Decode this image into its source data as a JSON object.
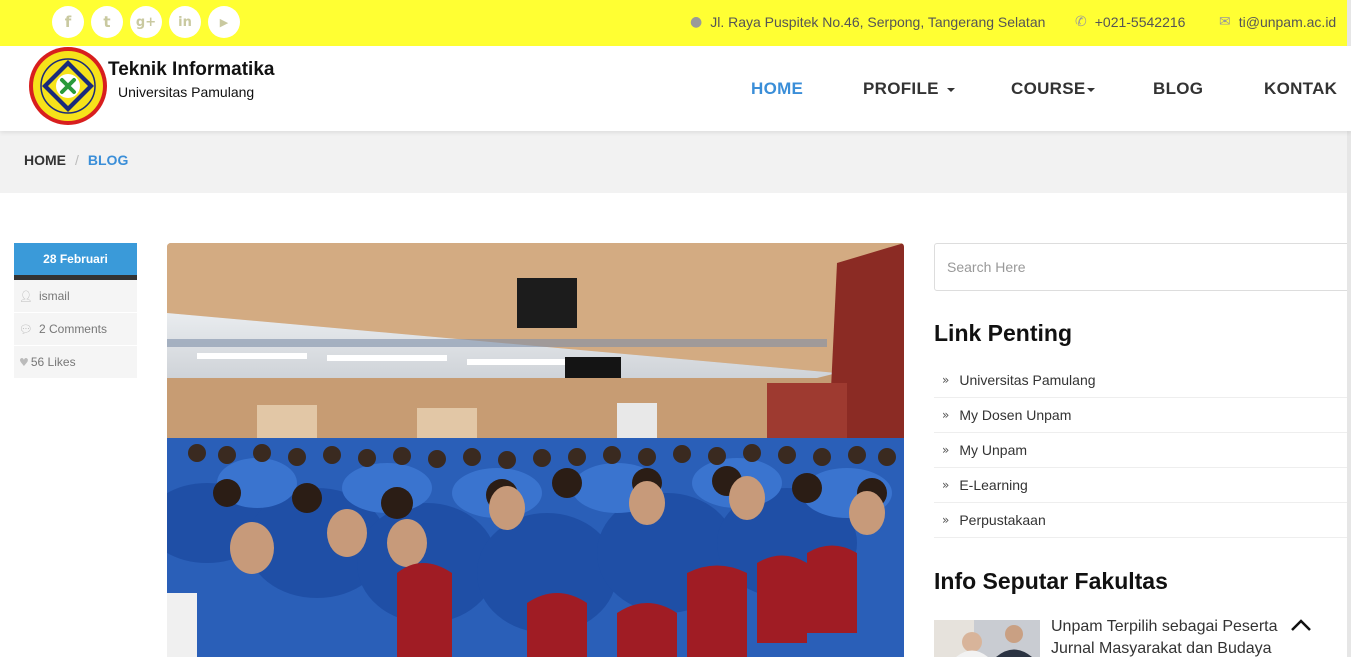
{
  "topbar": {
    "social": [
      {
        "icon": "facebook-icon",
        "glyph": "f"
      },
      {
        "icon": "twitter-icon",
        "glyph": "t"
      },
      {
        "icon": "google-plus-icon",
        "glyph": "g+"
      },
      {
        "icon": "linkedin-icon",
        "glyph": "in"
      },
      {
        "icon": "youtube-icon",
        "glyph": "▶"
      }
    ],
    "address": "Jl. Raya Puspitek No.46, Serpong, Tangerang Selatan",
    "phone": "+021-5542216",
    "email": "ti@unpam.ac.id",
    "color": "#ffff33"
  },
  "header": {
    "title": "Teknik Informatika",
    "subtitle": "Universitas Pamulang",
    "nav": {
      "home": "HOME",
      "profile": "PROFILE",
      "course": "COURSE",
      "blog": "BLOG",
      "kontak": "KONTAK"
    },
    "accent": "#3a8ed8"
  },
  "breadcrumb": {
    "home": "HOME",
    "sep": "/",
    "current": "BLOG"
  },
  "post": {
    "date": "28 Februari",
    "author": "ismail",
    "comments": "2 Comments",
    "likes": "56 Likes"
  },
  "sidebar": {
    "search_placeholder": "Search Here",
    "links_heading": "Link Penting",
    "links": [
      "Universitas Pamulang",
      "My Dosen Unpam",
      "My Unpam",
      "E-Learning",
      "Perpustakaan"
    ],
    "info_heading": "Info Seputar Fakultas",
    "news_title_1": "Unpam Terpilih sebagai Peserta",
    "news_title_2": "Jurnal Masyarakat dan Budaya"
  }
}
